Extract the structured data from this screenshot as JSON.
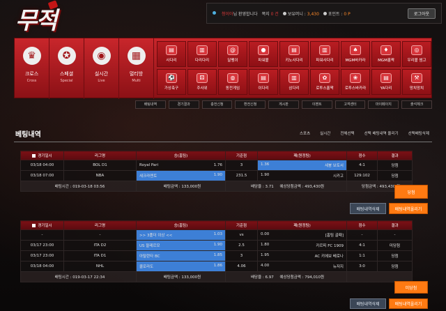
{
  "logo": "무적",
  "topbar": {
    "user_name": "청이아",
    "welcome": "님 환영합니다",
    "notes_label": "쪽지",
    "notes_count": "0 건",
    "money_label": "보유머니 :",
    "money_value": "3,430",
    "points_label": "포인트 :",
    "points_value": "0 P",
    "logout": "로그아웃"
  },
  "main_nav": [
    {
      "k": "크로스",
      "e": "Cross",
      "icon": "trophy-icon"
    },
    {
      "k": "스페셜",
      "e": "Special",
      "icon": "medal-icon"
    },
    {
      "k": "실시간",
      "e": "Live",
      "icon": "live-icon"
    },
    {
      "k": "멀티방",
      "e": "Multi",
      "icon": "multi-icon"
    }
  ],
  "game_grid": [
    "사다리",
    "다리다리",
    "달팽이",
    "파워볼",
    "키노사다리",
    "파워사다리",
    "MGM바카라",
    "MGM홀짝",
    "우리볼 썸고",
    "가상축구",
    "주사위",
    "동전게임",
    "이다리",
    "삼다리",
    "로투스홀짝",
    "로투스바카라",
    "YA다리",
    "망치망치"
  ],
  "sub_nav": [
    "배팅내역",
    "경기결과",
    "충전신청",
    "환전신청",
    "게시판",
    "이벤트",
    "고객센터",
    "마이페이지",
    "출석체크"
  ],
  "page_title": "베팅내역",
  "title_tabs": [
    "스포츠",
    "실시간",
    "전체선택",
    "선택 배팅내역 올리기",
    "선택배팅삭제"
  ],
  "columns": [
    "경기일시",
    "리그명",
    "승(홈팀)",
    "기준점",
    "패(원정팀)",
    "점수",
    "결과"
  ],
  "bet1": {
    "rows": [
      {
        "date": "03/18 04:00",
        "league": "BOL D1",
        "home": "Royal Pari",
        "home_odds": "1.76",
        "base": "3",
        "away": "1.36",
        "away_team": "세붕 보토서",
        "score": "4:1",
        "result": "당첨",
        "away_hl": true
      },
      {
        "date": "03/18 07:00",
        "league": "NBA",
        "home": "새크라멘토",
        "home_odds": "1.90",
        "base": "231.5",
        "away": "1.90",
        "away_team": "시카고",
        "score": "129:102",
        "result": "당첨",
        "home_hl": true
      }
    ],
    "summary": {
      "time": "배팅시간 : 019-03-18 03:56",
      "amount": "배팅금액 : 133,000원",
      "rate": "배당율 : 3.71",
      "expected": "예상당첨금액 : 493,430원",
      "win_amount": "당첨금액 : 493,430 원",
      "status": "당첨"
    },
    "delete": "배팅내역삭제",
    "upload": "배팅내역올리기"
  },
  "bet2": {
    "rows": [
      {
        "date": "-",
        "league": "-",
        "home": ">> 3폴더 이상 <<",
        "home_odds": "1.03",
        "base": "vs",
        "away": "0.00",
        "away_team": "[홈팀 골패]",
        "score": "-",
        "result": "-",
        "home_hl": true
      },
      {
        "date": "03/17 23:00",
        "league": "ITA D2",
        "home": "US 팔레르모",
        "home_odds": "1.90",
        "base": "2.5",
        "away": "1.80",
        "away_team": "카르피 FC 1909",
        "score": "4:1",
        "result": "미당첨",
        "home_hl": true
      },
      {
        "date": "03/17 23:00",
        "league": "ITA D1",
        "home": "아탈란타 BC",
        "home_odds": "1.85",
        "base": "3",
        "away": "1.95",
        "away_team": "AC 키에보 베로나",
        "score": "1:1",
        "result": "당첨",
        "home_hl": true
      },
      {
        "date": "03/18 04:00",
        "league": "NHL",
        "home": "콜로라도",
        "home_odds": "1.86",
        "base": "4.06",
        "away": "4.00",
        "away_team": "뉴저지",
        "score": "3:0",
        "result": "당첨",
        "home_hl": true
      }
    ],
    "summary": {
      "time": "배팅시간 : 019-03-17 22:34",
      "amount": "배팅금액 : 133,000원",
      "rate": "배당율 : 6.97",
      "expected": "예상당첨금액 : 794,010원",
      "win_amount": "",
      "status": "미당첨"
    },
    "delete": "배팅내역삭제",
    "upload": "배팅내역올리기"
  }
}
